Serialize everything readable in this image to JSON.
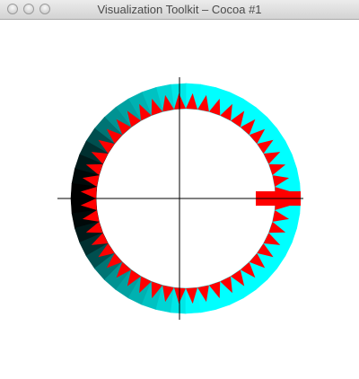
{
  "window": {
    "title": "Visualization Toolkit – Cocoa #1",
    "buttons": [
      "close",
      "minimize",
      "zoom"
    ]
  },
  "scene": {
    "background": "#ffffff",
    "ring": {
      "segments": 48,
      "colors": {
        "light": "#00ffff",
        "shade": "#008c8c",
        "dark": "#000000",
        "spike": "#ff0000"
      }
    },
    "axes_color": "#000000"
  }
}
